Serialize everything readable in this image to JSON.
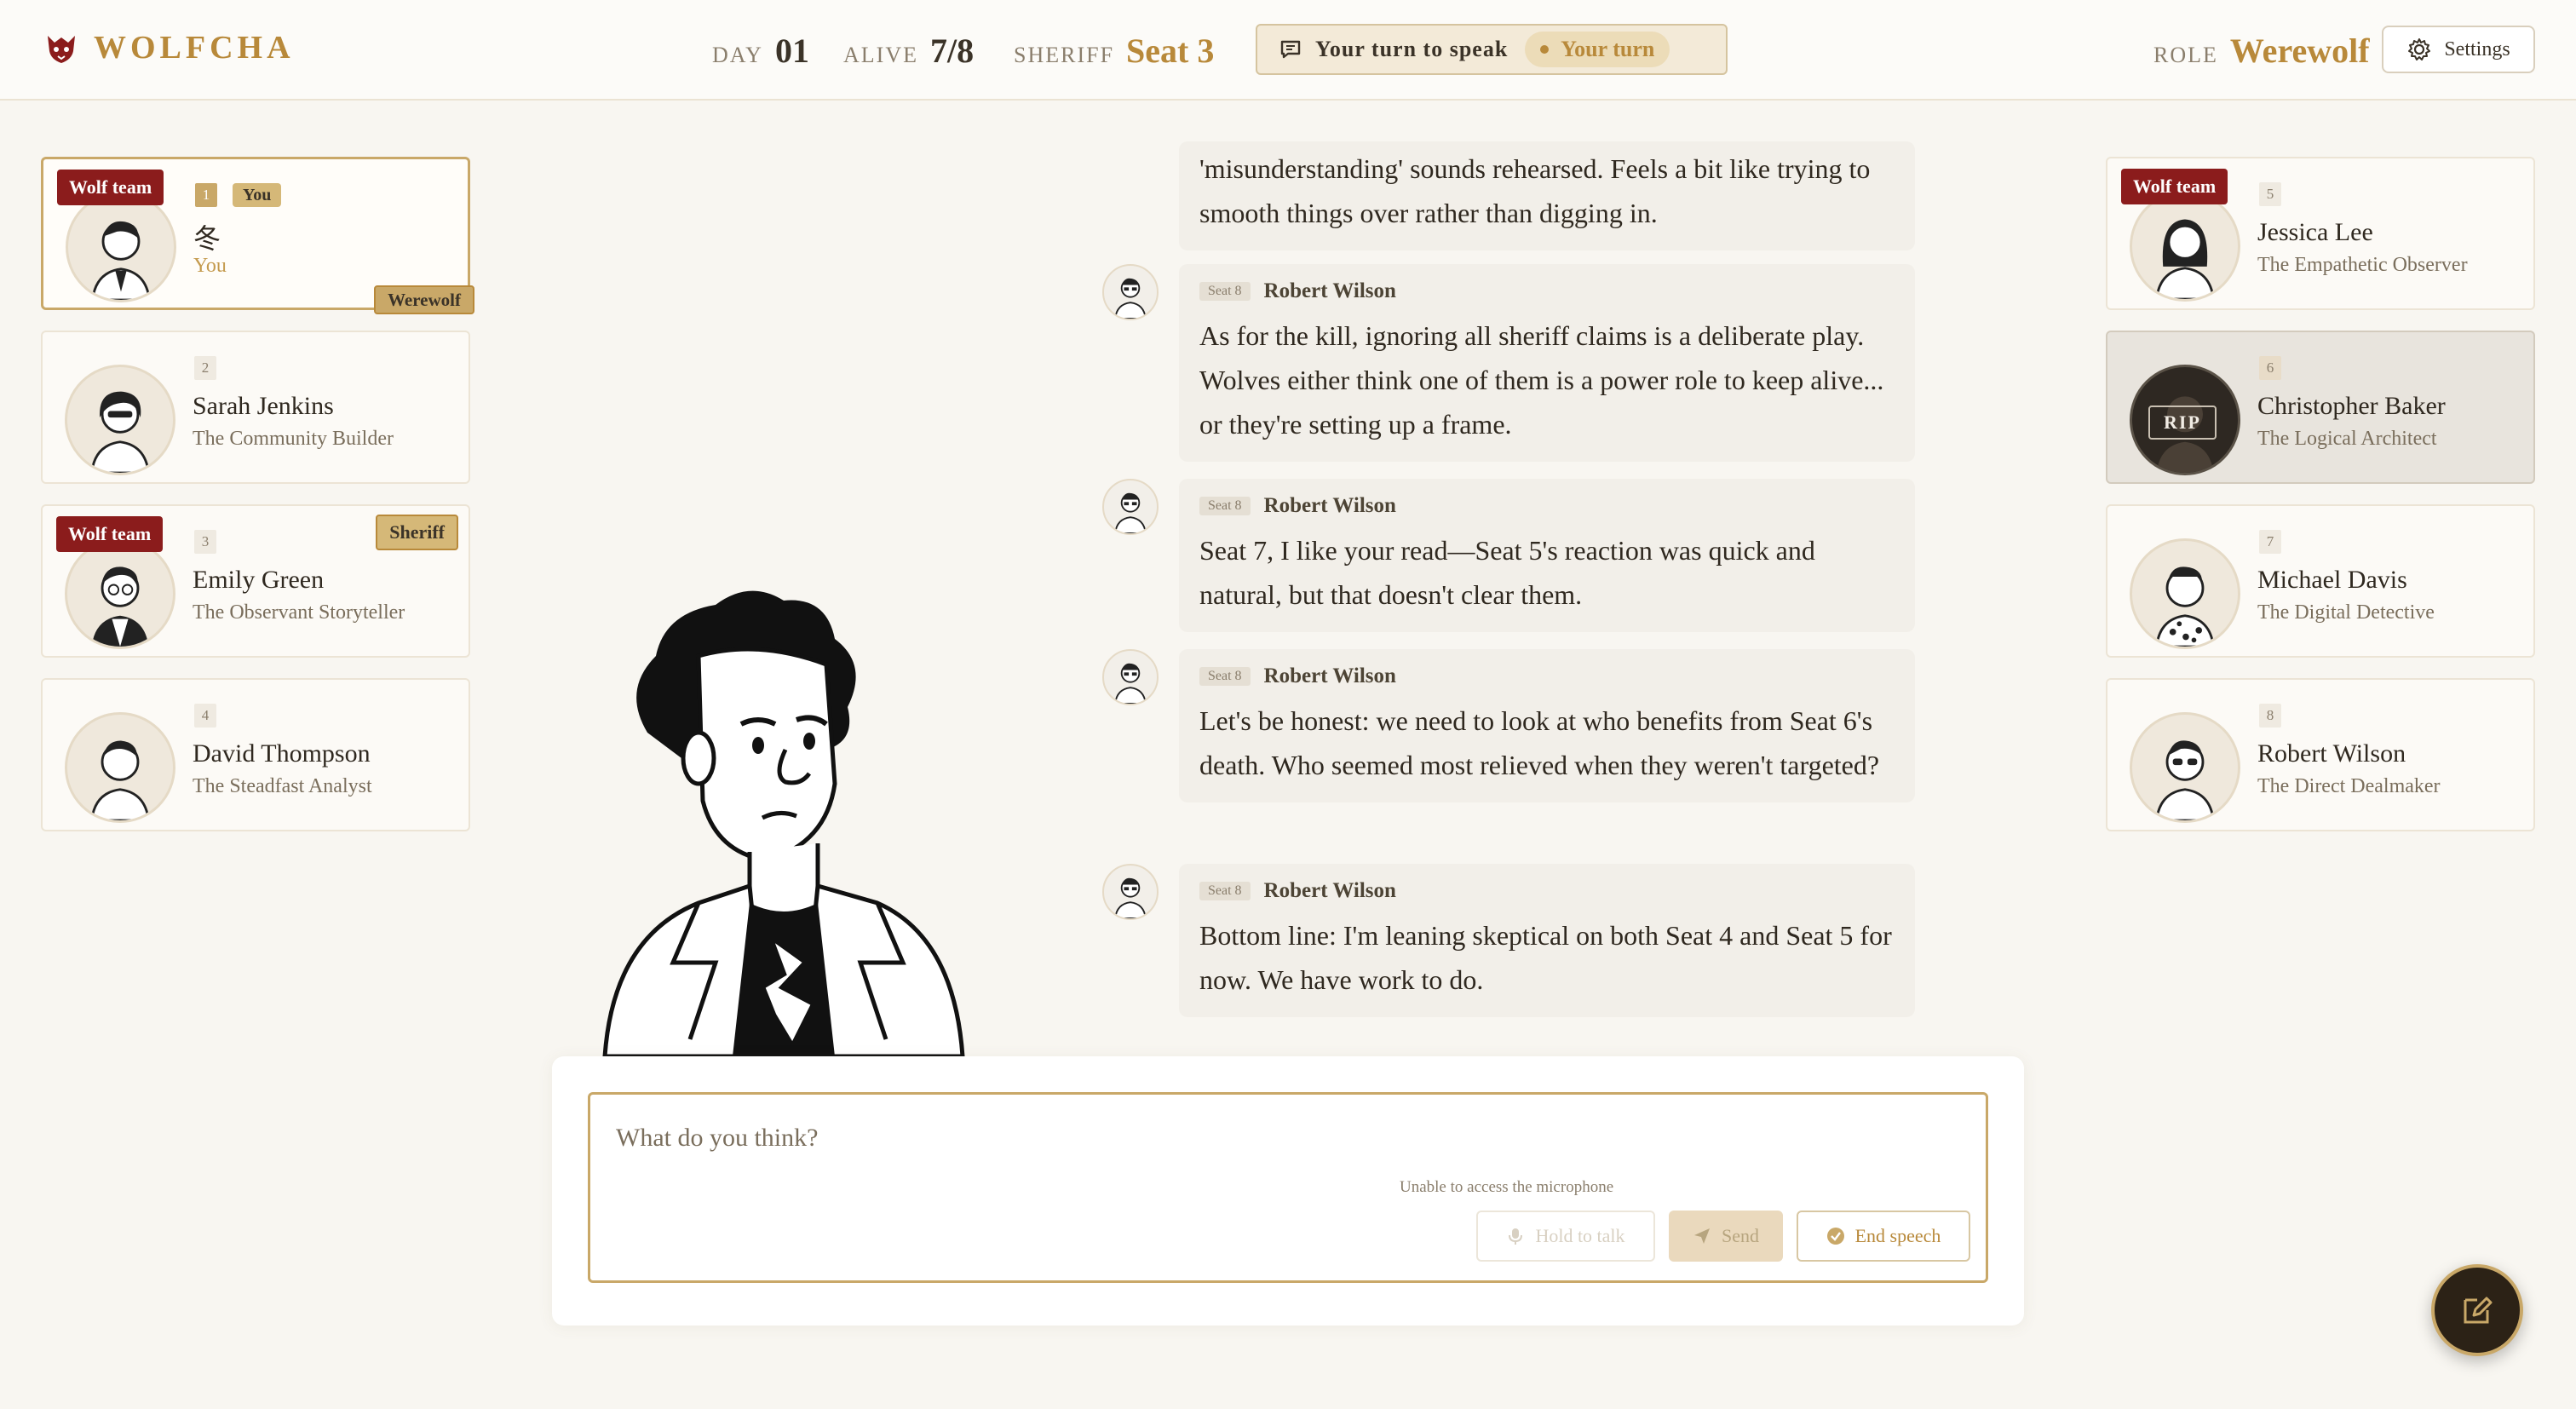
{
  "app": {
    "title": "WOLFCHA"
  },
  "header": {
    "day_label": "DAY",
    "day_value": "01",
    "alive_label": "ALIVE",
    "alive_value": "7/8",
    "sheriff_label": "SHERIFF",
    "sheriff_value": "Seat 3",
    "turn_text": "Your turn to speak",
    "turn_pill": "Your turn",
    "role_label": "ROLE",
    "role_value": "Werewolf",
    "settings_label": "Settings"
  },
  "players": [
    {
      "seat": "1",
      "name": "冬",
      "title": "You",
      "you_badge": "You",
      "team_badge": "Wolf team",
      "role_badge": "Werewolf"
    },
    {
      "seat": "2",
      "name": "Sarah Jenkins",
      "title": "The Community Builder"
    },
    {
      "seat": "3",
      "name": "Emily Green",
      "title": "The Observant Storyteller",
      "team_badge": "Wolf team",
      "sheriff_badge": "Sheriff"
    },
    {
      "seat": "4",
      "name": "David Thompson",
      "title": "The Steadfast Analyst"
    },
    {
      "seat": "5",
      "name": "Jessica Lee",
      "title": "The Empathetic Observer",
      "team_badge": "Wolf team"
    },
    {
      "seat": "6",
      "name": "Christopher Baker",
      "title": "The Logical Architect",
      "dead_label": "RIP"
    },
    {
      "seat": "7",
      "name": "Michael Davis",
      "title": "The Digital Detective"
    },
    {
      "seat": "8",
      "name": "Robert Wilson",
      "title": "The Direct Dealmaker"
    }
  ],
  "chat": {
    "partial": "'misunderstanding' sounds rehearsed. Feels a bit like trying to smooth things over rather than digging in.",
    "messages": [
      {
        "seat": "Seat 8",
        "author": "Robert Wilson",
        "text": "As for the kill, ignoring all sheriff claims is a deliberate play. Wolves either think one of them is a power role to keep alive... or they're setting up a frame."
      },
      {
        "seat": "Seat 8",
        "author": "Robert Wilson",
        "text": "Seat 7, I like your read—Seat 5's reaction was quick and natural, but that doesn't clear them."
      },
      {
        "seat": "Seat 8",
        "author": "Robert Wilson",
        "text": "Let's be honest: we need to look at who benefits from Seat 6's death. Who seemed most relieved when they weren't targeted?"
      },
      {
        "seat": "Seat 8",
        "author": "Robert Wilson",
        "text": "Bottom line: I'm leaning skeptical on both Seat 4 and Seat 5 for now. We have work to do."
      }
    ]
  },
  "input": {
    "placeholder": "What do you think?",
    "mic_error": "Unable to access the microphone",
    "hold_label": "Hold to talk",
    "send_label": "Send",
    "end_label": "End speech"
  },
  "icons": [
    "wolf-logo-icon",
    "chat-bubble-icon",
    "gear-icon",
    "mic-icon",
    "send-icon",
    "check-circle-icon",
    "edit-icon"
  ],
  "colors": {
    "accent": "#b8893a",
    "wolf_team": "#8b1c1c",
    "background": "#f8f6f1"
  }
}
